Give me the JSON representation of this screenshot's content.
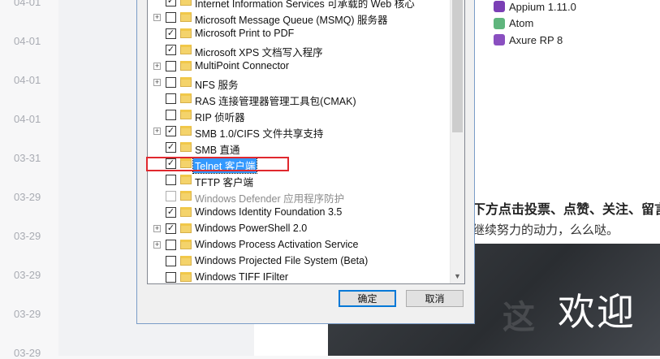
{
  "dates": [
    "04-01",
    "04-01",
    "04-01",
    "04-01",
    "03-31",
    "03-29",
    "03-29",
    "03-29",
    "03-29",
    "03-29"
  ],
  "apps": [
    {
      "name": "Appium 1.11.0",
      "icon": "appium-icon",
      "color": "#7b3fb5"
    },
    {
      "name": "Atom",
      "icon": "atom-icon",
      "color": "#5fb57d"
    },
    {
      "name": "Axure RP 8",
      "icon": "axure-icon",
      "color": "#8a4fc0"
    }
  ],
  "article": {
    "bold_text": "下方点击投票、点赞、关注、留言",
    "plain_text": "继续努力的动力，么么哒。",
    "image_text": "欢迎"
  },
  "features": [
    {
      "label": "Internet Information Services 可承载的 Web 核心",
      "expander": false,
      "state": "checked"
    },
    {
      "label": "Microsoft Message Queue (MSMQ) 服务器",
      "expander": true,
      "state": "unchecked"
    },
    {
      "label": "Microsoft Print to PDF",
      "expander": false,
      "state": "checked"
    },
    {
      "label": "Microsoft XPS 文档写入程序",
      "expander": false,
      "state": "checked"
    },
    {
      "label": "MultiPoint Connector",
      "expander": true,
      "state": "unchecked"
    },
    {
      "label": "NFS 服务",
      "expander": true,
      "state": "unchecked"
    },
    {
      "label": "RAS 连接管理器管理工具包(CMAK)",
      "expander": false,
      "state": "unchecked"
    },
    {
      "label": "RIP 侦听器",
      "expander": false,
      "state": "unchecked"
    },
    {
      "label": "SMB 1.0/CIFS 文件共享支持",
      "expander": true,
      "state": "checked"
    },
    {
      "label": "SMB 直通",
      "expander": false,
      "state": "checked"
    },
    {
      "label": "Telnet 客户端",
      "expander": false,
      "state": "checked",
      "selected": true
    },
    {
      "label": "TFTP 客户端",
      "expander": false,
      "state": "unchecked"
    },
    {
      "label": "Windows Defender 应用程序防护",
      "expander": false,
      "state": "unchecked",
      "disabled": true
    },
    {
      "label": "Windows Identity Foundation 3.5",
      "expander": false,
      "state": "checked"
    },
    {
      "label": "Windows PowerShell 2.0",
      "expander": true,
      "state": "checked"
    },
    {
      "label": "Windows Process Activation Service",
      "expander": true,
      "state": "unchecked"
    },
    {
      "label": "Windows Projected File System (Beta)",
      "expander": false,
      "state": "unchecked"
    },
    {
      "label": "Windows TIFF IFilter",
      "expander": false,
      "state": "unchecked"
    }
  ],
  "buttons": {
    "ok": "确定",
    "cancel": "取消"
  }
}
